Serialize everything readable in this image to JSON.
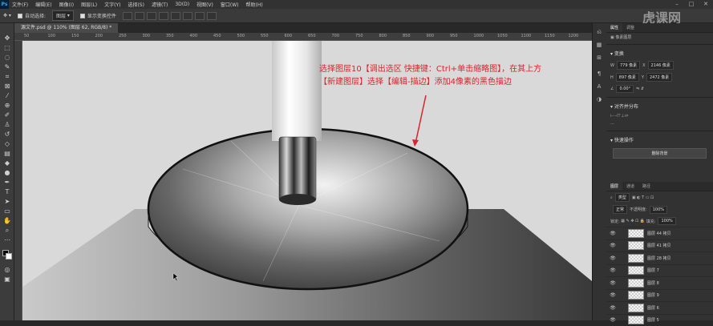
{
  "menubar": {
    "items": [
      "文件(F)",
      "编辑(E)",
      "图像(I)",
      "图层(L)",
      "文字(Y)",
      "选择(S)",
      "滤镜(T)",
      "3D(D)",
      "视图(V)",
      "窗口(W)",
      "帮助(H)"
    ]
  },
  "options": {
    "auto_select": "自动选择:",
    "target": "图层",
    "show_transform": "显示变换控件"
  },
  "watermark": "虎课网",
  "document_tab": "源文件.psd @ 110% (图层 62, RGB/8) *",
  "ruler_ticks": [
    "50",
    "100",
    "150",
    "200",
    "250",
    "300",
    "350",
    "400",
    "450",
    "500",
    "550",
    "600",
    "650",
    "700",
    "750",
    "800",
    "850",
    "900",
    "950",
    "1000",
    "1050",
    "1100",
    "1150",
    "1200"
  ],
  "annotation": {
    "line1": "选择图层10【调出选区 快捷键：Ctrl+单击缩略图】，在其上方",
    "line2": "【新建图层】选择【编辑-描边】添加4像素的黑色描边"
  },
  "panel": {
    "top_tabs": [
      "属性",
      "调整"
    ],
    "pixel_layer": "像素图层",
    "transform_title": "变换",
    "w_label": "W",
    "w_value": "779 像素",
    "x_label": "X",
    "x_value": "2146 像素",
    "h_label": "H",
    "h_value": "897 像素",
    "y_label": "Y",
    "y_value": "2472 像素",
    "angle_value": "0.00°",
    "align_title": "对齐并分布",
    "quick_actions_title": "快速操作",
    "remove_bg_button": "删除背景",
    "layers_tabs": [
      "图层",
      "通道",
      "路径"
    ],
    "kind_filter": "类型",
    "blend_mode": "正常",
    "opacity_label": "不透明度:",
    "opacity_value": "100%",
    "lock_label": "锁定:",
    "fill_label": "填充:",
    "fill_value": "100%",
    "layers": [
      "图层 44 拷贝",
      "图层 41 拷贝",
      "图层 28 拷贝",
      "图层 7",
      "图层 8",
      "图层 9",
      "图层 6",
      "图层 5"
    ]
  },
  "colors": {
    "annotation": "#d9242c",
    "canvas_bg": "#d9d9d9",
    "ui_dark": "#323232"
  }
}
